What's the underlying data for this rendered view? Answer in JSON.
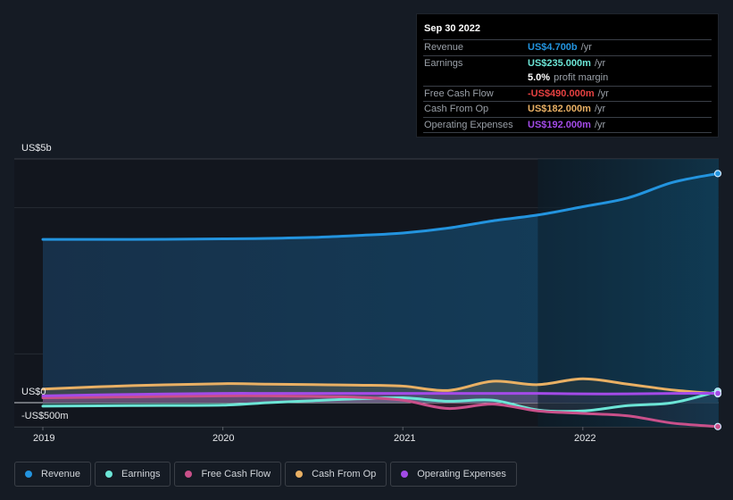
{
  "tooltip": {
    "date": "Sep 30 2022",
    "rows": [
      {
        "label": "Revenue",
        "value": "US$4.700b",
        "unit": "/yr",
        "color": "#2394df"
      },
      {
        "label": "Earnings",
        "value": "US$235.000m",
        "unit": "/yr",
        "color": "#6ce5d6"
      },
      {
        "label": "",
        "value": "5.0%",
        "unit": "profit margin",
        "color": "#ffffff"
      },
      {
        "label": "Free Cash Flow",
        "value": "-US$490.000m",
        "unit": "/yr",
        "color": "#e64141"
      },
      {
        "label": "Cash From Op",
        "value": "US$182.000m",
        "unit": "/yr",
        "color": "#e9b064"
      },
      {
        "label": "Operating Expenses",
        "value": "US$192.000m",
        "unit": "/yr",
        "color": "#a34be8"
      }
    ]
  },
  "legend": [
    {
      "label": "Revenue",
      "color": "#2394df"
    },
    {
      "label": "Earnings",
      "color": "#6ce5d6"
    },
    {
      "label": "Free Cash Flow",
      "color": "#c9508a"
    },
    {
      "label": "Cash From Op",
      "color": "#e9b064"
    },
    {
      "label": "Operating Expenses",
      "color": "#a34be8"
    }
  ],
  "chart_data": {
    "type": "area",
    "title": "",
    "xlabel": "",
    "ylabel": "",
    "y_unit": "US$ billions",
    "ylim": [
      -0.5,
      5.0
    ],
    "xlim": [
      2019.0,
      2022.75
    ],
    "y_tick_labels": [
      {
        "value": 5.0,
        "label": "US$5b"
      },
      {
        "value": 0.0,
        "label": "US$0"
      },
      {
        "value": -0.5,
        "label": "-US$500m"
      }
    ],
    "x_tick_labels": [
      {
        "value": 2019,
        "label": "2019"
      },
      {
        "value": 2020,
        "label": "2020"
      },
      {
        "value": 2021,
        "label": "2021"
      },
      {
        "value": 2022,
        "label": "2022"
      }
    ],
    "highlight_start": 2021.75,
    "grid": true,
    "legend_position": "bottom",
    "series": [
      {
        "name": "Revenue",
        "color": "#2394df",
        "x": [
          2019.0,
          2019.5,
          2020.0,
          2020.25,
          2020.5,
          2020.75,
          2021.0,
          2021.25,
          2021.5,
          2021.75,
          2022.0,
          2022.25,
          2022.5,
          2022.75
        ],
        "values": [
          3.35,
          3.35,
          3.36,
          3.37,
          3.39,
          3.43,
          3.48,
          3.58,
          3.73,
          3.85,
          4.02,
          4.2,
          4.52,
          4.7
        ]
      },
      {
        "name": "Earnings",
        "color": "#6ce5d6",
        "x": [
          2019.0,
          2019.5,
          2020.0,
          2020.25,
          2020.5,
          2020.75,
          2021.0,
          2021.25,
          2021.5,
          2021.75,
          2022.0,
          2022.25,
          2022.5,
          2022.75
        ],
        "values": [
          -0.07,
          -0.06,
          -0.05,
          0.0,
          0.04,
          0.08,
          0.1,
          0.03,
          0.05,
          -0.15,
          -0.17,
          -0.06,
          0.0,
          0.235
        ]
      },
      {
        "name": "Free Cash Flow",
        "color": "#c9508a",
        "x": [
          2019.0,
          2019.5,
          2020.0,
          2020.25,
          2020.5,
          2020.75,
          2021.0,
          2021.25,
          2021.5,
          2021.75,
          2022.0,
          2022.25,
          2022.5,
          2022.75
        ],
        "values": [
          0.1,
          0.12,
          0.14,
          0.14,
          0.13,
          0.11,
          0.05,
          -0.12,
          -0.03,
          -0.17,
          -0.22,
          -0.27,
          -0.42,
          -0.49
        ]
      },
      {
        "name": "Cash From Op",
        "color": "#e9b064",
        "x": [
          2019.0,
          2019.5,
          2020.0,
          2020.25,
          2020.5,
          2020.75,
          2021.0,
          2021.25,
          2021.5,
          2021.75,
          2022.0,
          2022.25,
          2022.5,
          2022.75
        ],
        "values": [
          0.28,
          0.35,
          0.39,
          0.38,
          0.37,
          0.36,
          0.34,
          0.25,
          0.44,
          0.37,
          0.49,
          0.38,
          0.26,
          0.182
        ]
      },
      {
        "name": "Operating Expenses",
        "color": "#a34be8",
        "x": [
          2019.0,
          2019.5,
          2020.0,
          2020.25,
          2020.5,
          2020.75,
          2021.0,
          2021.25,
          2021.5,
          2021.75,
          2022.0,
          2022.25,
          2022.5,
          2022.75
        ],
        "values": [
          0.14,
          0.17,
          0.19,
          0.19,
          0.19,
          0.19,
          0.19,
          0.19,
          0.19,
          0.19,
          0.18,
          0.18,
          0.19,
          0.192
        ]
      }
    ]
  }
}
